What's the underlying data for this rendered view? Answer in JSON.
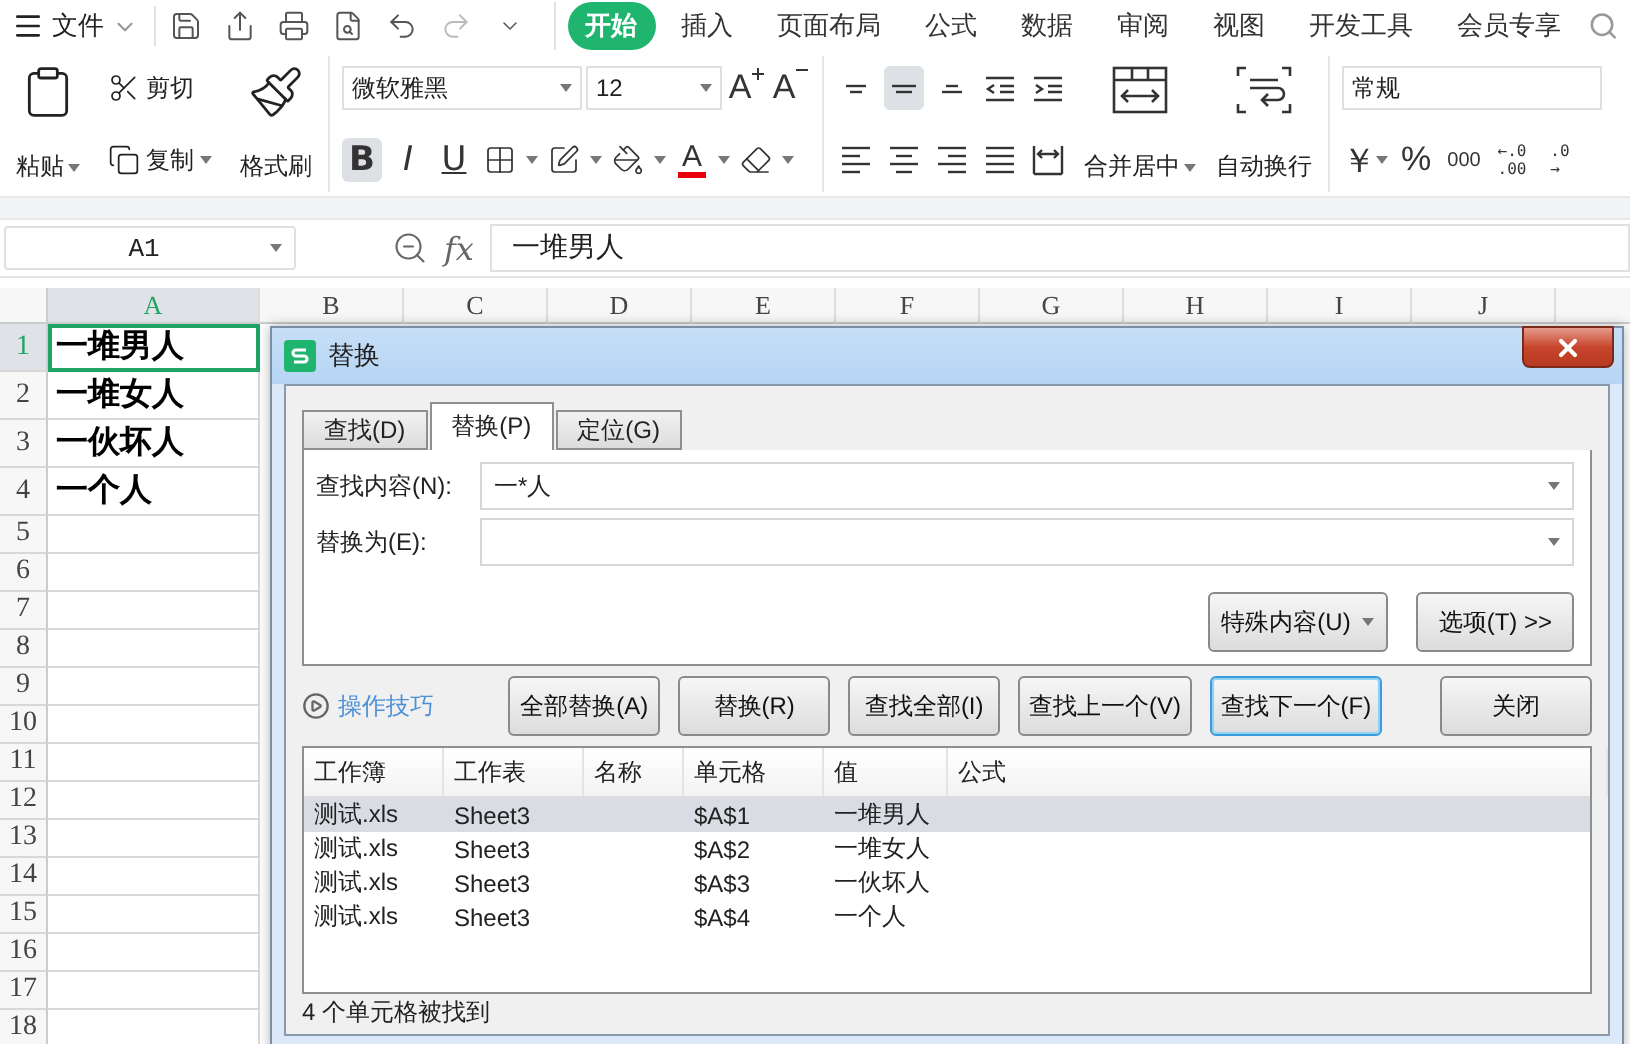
{
  "menu_bar": {
    "file_menu": "文件",
    "quick_access": [
      {
        "kind": "save",
        "disabled": false
      },
      {
        "kind": "share",
        "disabled": false
      },
      {
        "kind": "print",
        "disabled": false
      },
      {
        "kind": "preview",
        "disabled": false
      },
      {
        "kind": "undo",
        "disabled": false
      },
      {
        "kind": "redo",
        "disabled": true
      },
      {
        "kind": "more",
        "disabled": false
      }
    ],
    "tabs": [
      {
        "label": "开始",
        "selected": true
      },
      {
        "label": "插入",
        "selected": false
      },
      {
        "label": "页面布局",
        "selected": false
      },
      {
        "label": "公式",
        "selected": false
      },
      {
        "label": "数据",
        "selected": false
      },
      {
        "label": "审阅",
        "selected": false
      },
      {
        "label": "视图",
        "selected": false
      },
      {
        "label": "开发工具",
        "selected": false
      },
      {
        "label": "会员专享",
        "selected": false
      }
    ]
  },
  "ribbon": {
    "clipboard": {
      "paste": "粘贴",
      "cut": "剪切",
      "copy": "复制",
      "format_painter": "格式刷"
    },
    "font": {
      "name": "微软雅黑",
      "size": "12",
      "grow": "A",
      "shrink": "A",
      "font_color": "A",
      "styles": [
        {
          "kind": "bold",
          "label": "B",
          "active": true
        },
        {
          "kind": "italic",
          "label": "I",
          "active": false
        },
        {
          "kind": "underline",
          "label": "U",
          "active": false
        }
      ]
    },
    "alignment": {
      "vertical": [
        {
          "kind": "top",
          "active": false
        },
        {
          "kind": "middle",
          "active": true
        },
        {
          "kind": "bottom",
          "active": false
        }
      ],
      "horizontal": [
        {
          "kind": "left",
          "active": false
        },
        {
          "kind": "center",
          "active": false
        },
        {
          "kind": "right",
          "active": false
        },
        {
          "kind": "justify",
          "active": false
        }
      ],
      "merge": "合并居中",
      "wrap": "自动换行"
    },
    "number": {
      "format": "常规",
      "currency": "￥",
      "percent": "%",
      "thousands": "000",
      "increase_decimal": [
        "←.0",
        ".00"
      ],
      "decrease_decimal": [
        ".0",
        "→"
      ]
    }
  },
  "formula_bar": {
    "name_box": "A1",
    "fx": "fx",
    "value": "一堆男人"
  },
  "sheet": {
    "columns": [
      {
        "label": "A",
        "selected": true
      },
      {
        "label": "B",
        "selected": false
      },
      {
        "label": "C",
        "selected": false
      },
      {
        "label": "D",
        "selected": false
      },
      {
        "label": "E",
        "selected": false
      },
      {
        "label": "F",
        "selected": false
      },
      {
        "label": "G",
        "selected": false
      },
      {
        "label": "H",
        "selected": false
      },
      {
        "label": "I",
        "selected": false
      },
      {
        "label": "J",
        "selected": false
      }
    ],
    "rows": [
      {
        "number": "1",
        "selected": true,
        "value": "一堆男人"
      },
      {
        "number": "2",
        "selected": false,
        "value": "一堆女人"
      },
      {
        "number": "3",
        "selected": false,
        "value": "一伙坏人"
      },
      {
        "number": "4",
        "selected": false,
        "value": "一个人"
      },
      {
        "number": "5",
        "selected": false
      },
      {
        "number": "6",
        "selected": false
      },
      {
        "number": "7",
        "selected": false
      },
      {
        "number": "8",
        "selected": false
      },
      {
        "number": "9",
        "selected": false
      },
      {
        "number": "10",
        "selected": false
      },
      {
        "number": "11",
        "selected": false
      },
      {
        "number": "12",
        "selected": false
      },
      {
        "number": "13",
        "selected": false
      },
      {
        "number": "14",
        "selected": false
      },
      {
        "number": "15",
        "selected": false
      },
      {
        "number": "16",
        "selected": false
      },
      {
        "number": "17",
        "selected": false
      },
      {
        "number": "18",
        "selected": false
      }
    ]
  },
  "dialog": {
    "title": "替换",
    "tabs": [
      {
        "label": "查找(D)",
        "selected": false
      },
      {
        "label": "替换(P)",
        "selected": true
      },
      {
        "label": "定位(G)",
        "selected": false
      }
    ],
    "find_label": "查找内容(N):",
    "find_value": "一*人",
    "replace_label": "替换为(E):",
    "special_button": "特殊内容(U)",
    "options_button": "选项(T) >>",
    "tips_link": "操作技巧",
    "buttons": [
      {
        "label": "全部替换(A)",
        "focused": false
      },
      {
        "label": "替换(R)",
        "focused": false
      },
      {
        "label": "查找全部(I)",
        "focused": false
      },
      {
        "label": "查找上一个(V)",
        "focused": false
      },
      {
        "label": "查找下一个(F)",
        "focused": true
      },
      {
        "label": "关闭",
        "focused": false
      }
    ],
    "results": {
      "columns": [
        "工作簿",
        "工作表",
        "名称",
        "单元格",
        "值",
        "公式"
      ],
      "rows": [
        {
          "workbook": "测试.xls",
          "sheet": "Sheet3",
          "cell": "$A$1",
          "value": "一堆男人",
          "selected": true
        },
        {
          "workbook": "测试.xls",
          "sheet": "Sheet3",
          "cell": "$A$2",
          "value": "一堆女人",
          "selected": false
        },
        {
          "workbook": "测试.xls",
          "sheet": "Sheet3",
          "cell": "$A$3",
          "value": "一伙坏人",
          "selected": false
        },
        {
          "workbook": "测试.xls",
          "sheet": "Sheet3",
          "cell": "$A$4",
          "value": "一个人",
          "selected": false
        }
      ]
    },
    "status": "4 个单元格被找到"
  }
}
